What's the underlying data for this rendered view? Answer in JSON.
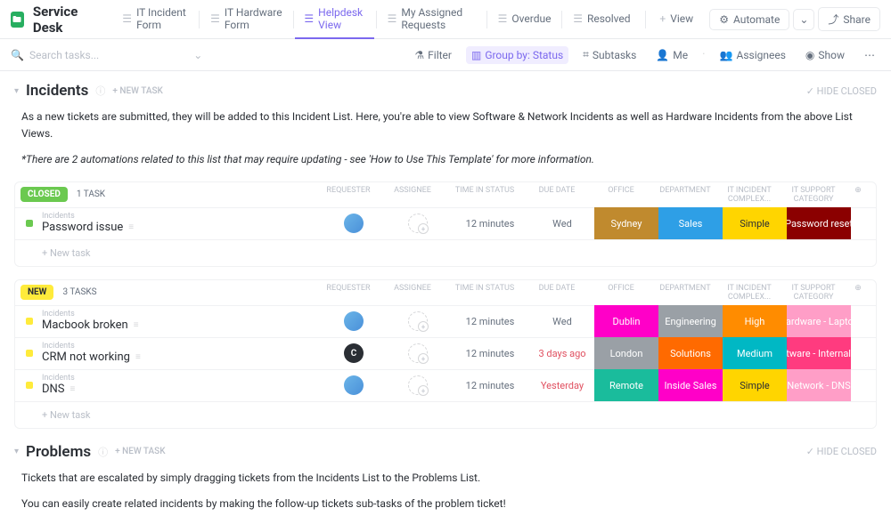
{
  "header": {
    "title": "Service Desk",
    "tabs": [
      {
        "label": "IT Incident Form"
      },
      {
        "label": "IT Hardware Form"
      },
      {
        "label": "Helpdesk View",
        "active": true
      },
      {
        "label": "My Assigned Requests"
      },
      {
        "label": "Overdue"
      },
      {
        "label": "Resolved"
      }
    ],
    "add_view": "View",
    "automate": "Automate",
    "share": "Share"
  },
  "toolbar": {
    "search_placeholder": "Search tasks...",
    "filter": "Filter",
    "group_by": "Group by: Status",
    "subtasks": "Subtasks",
    "me": "Me",
    "assignees": "Assignees",
    "show": "Show"
  },
  "sections": [
    {
      "title": "Incidents",
      "new_task": "+ NEW TASK",
      "hide_closed": "HIDE CLOSED",
      "desc_lines": [
        "As a new tickets are submitted, they will be added to this Incident List. Here, you're able to view Software & Network Incidents as well as Hardware Incidents from the above List Views.",
        "<i>*There are 2 automations related to this list that may require updating - see 'How to Use This Template' for more information.</i>"
      ],
      "columns": [
        "REQUESTER",
        "ASSIGNEE",
        "TIME IN STATUS",
        "DUE DATE",
        "OFFICE",
        "DEPARTMENT",
        "IT INCIDENT COMPLEX...",
        "IT SUPPORT CATEGORY"
      ],
      "groups": [
        {
          "status": "CLOSED",
          "status_class": "closed",
          "count": "1 TASK",
          "rows": [
            {
              "path": "Incidents",
              "name": "Password issue",
              "avatar": "",
              "time": "12 minutes",
              "due": "Wed",
              "overdue": false,
              "tags": [
                {
                  "t": "Sydney",
                  "c": "#c08a2e"
                },
                {
                  "t": "Sales",
                  "c": "#2e9fe6"
                },
                {
                  "t": "Simple",
                  "c": "#ffd500",
                  "fc": "#2a2e34"
                },
                {
                  "t": "Password reset",
                  "c": "#8b0000"
                }
              ]
            }
          ],
          "new_task": "+ New task"
        },
        {
          "status": "NEW",
          "status_class": "new",
          "count": "3 TASKS",
          "rows": [
            {
              "path": "Incidents",
              "name": "Macbook broken",
              "avatar": "",
              "time": "12 minutes",
              "due": "Wed",
              "overdue": false,
              "tags": [
                {
                  "t": "Dublin",
                  "c": "#ff00c8"
                },
                {
                  "t": "Engineering",
                  "c": "#9aa0a6"
                },
                {
                  "t": "High",
                  "c": "#ff8c00"
                },
                {
                  "t": "Hardware - Laptop",
                  "c": "#ff9ec7"
                }
              ]
            },
            {
              "path": "Incidents",
              "name": "CRM not working",
              "avatar": "C",
              "avatar_dark": true,
              "time": "12 minutes",
              "due": "3 days ago",
              "overdue": true,
              "tags": [
                {
                  "t": "London",
                  "c": "#9aa0a6"
                },
                {
                  "t": "Solutions",
                  "c": "#ff6a00"
                },
                {
                  "t": "Medium",
                  "c": "#00b8c4"
                },
                {
                  "t": "Software - Internal a...",
                  "c": "#ff3b7f"
                }
              ]
            },
            {
              "path": "Incidents",
              "name": "DNS",
              "avatar": "",
              "time": "12 minutes",
              "due": "Yesterday",
              "overdue": true,
              "tags": [
                {
                  "t": "Remote",
                  "c": "#1abc9c"
                },
                {
                  "t": "Inside Sales",
                  "c": "#ff00c8"
                },
                {
                  "t": "Simple",
                  "c": "#ffd500",
                  "fc": "#2a2e34"
                },
                {
                  "t": "Network - DNS",
                  "c": "#ff9ec7"
                }
              ]
            }
          ],
          "new_task": "+ New task"
        }
      ]
    },
    {
      "title": "Problems",
      "new_task": "+ NEW TASK",
      "hide_closed": "HIDE CLOSED",
      "desc_lines": [
        "Tickets that are escalated by simply dragging tickets from the Incidents List to the Problems List.",
        "You can easily create related incidents by making the follow-up tickets sub-tasks of the problem ticket!"
      ],
      "groups": []
    }
  ]
}
